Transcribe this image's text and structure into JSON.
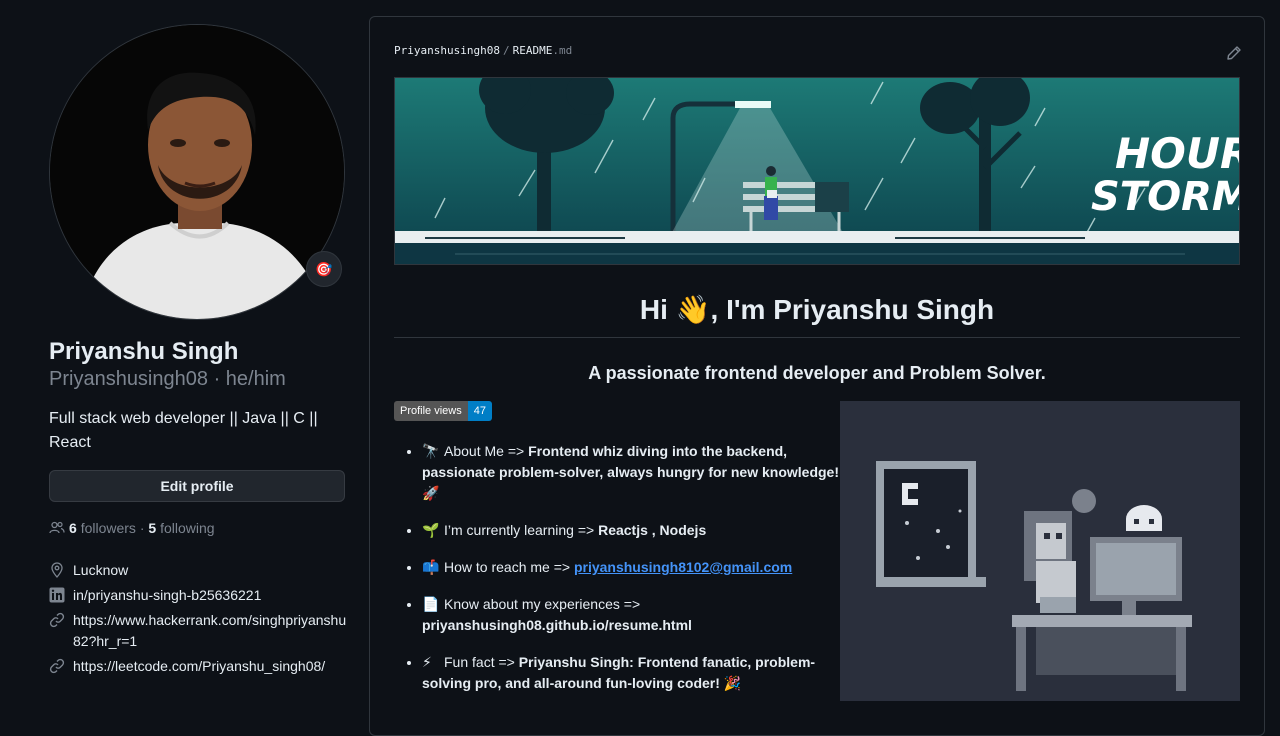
{
  "profile": {
    "name": "Priyanshu Singh",
    "login": "Priyanshusingh08",
    "pronouns": "he/him",
    "bio": "Full stack web developer || Java || C || React",
    "edit_label": "Edit profile",
    "followers_count": "6",
    "followers_label": "followers",
    "following_count": "5",
    "following_label": "following",
    "location": "Lucknow",
    "linkedin": "in/priyanshu-singh-b25636221",
    "link1": "https://www.hackerrank.com/singhpriyanshu82?hr_r=1",
    "link2": "https://leetcode.com/Priyanshu_singh08/"
  },
  "readme": {
    "repo": "Priyanshusingh08",
    "file": "README",
    "ext": ".md",
    "banner_text_1": "HOUR",
    "banner_text_2": "STORM",
    "heading_pre": "Hi",
    "heading_post": ", I'm Priyanshu Singh",
    "subheading": "A passionate frontend developer and Problem Solver.",
    "badge_label": "Profile views",
    "badge_value": "47",
    "items": [
      {
        "icon": "🔭",
        "label": "About Me => ",
        "value": "Frontend whiz diving into the backend, passionate problem-solver, always hungry for new knowledge!",
        "tail": "🚀"
      },
      {
        "icon": "🌱",
        "label": "I’m currently learning => ",
        "value": "Reactjs , Nodejs",
        "tail": ""
      },
      {
        "icon": "📫",
        "label": "How to reach me => ",
        "value": "priyanshusingh8102@gmail.com",
        "tail": ""
      },
      {
        "icon": "📄",
        "label": "Know about my experiences => ",
        "value": "priyanshusingh08.github.io/resume.html",
        "tail": ""
      },
      {
        "icon": "⚡",
        "label": "Fun fact => ",
        "value": "Priyanshu Singh: Frontend fanatic, problem-solving pro, and all-around fun-loving coder!",
        "tail": "🎉"
      }
    ]
  },
  "colors": {
    "bg": "#0d1117",
    "accent": "#4493f8",
    "muted": "#7d8590",
    "border": "#30363d"
  }
}
